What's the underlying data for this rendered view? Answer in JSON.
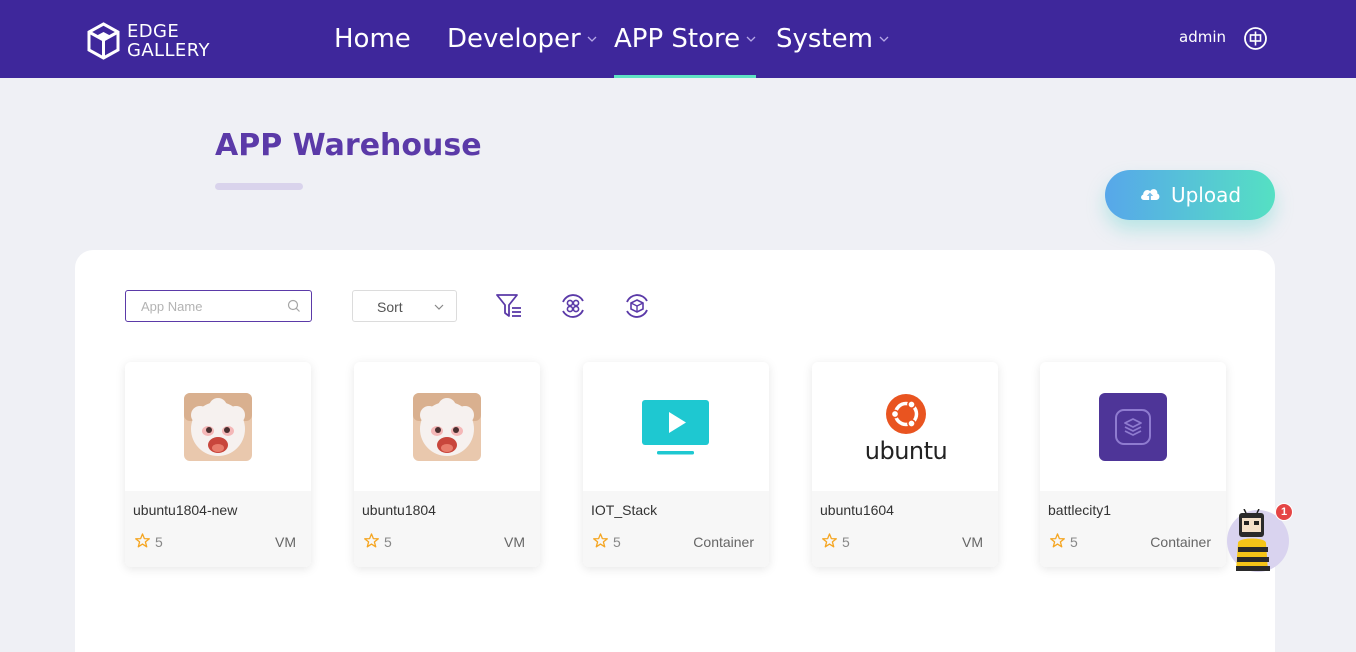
{
  "header": {
    "logo_line1": "EDGE",
    "logo_line2": "GALLERY",
    "nav": [
      {
        "label": "Home",
        "has_dropdown": false,
        "active": false
      },
      {
        "label": "Developer",
        "has_dropdown": true,
        "active": false
      },
      {
        "label": "APP Store",
        "has_dropdown": true,
        "active": true
      },
      {
        "label": "System",
        "has_dropdown": true,
        "active": false
      }
    ],
    "user": "admin",
    "lang_icon": "globe-chinese-icon"
  },
  "page": {
    "title": "APP Warehouse",
    "upload_label": "Upload"
  },
  "toolbar": {
    "search_placeholder": "App Name",
    "sort_label": "Sort",
    "tools": [
      "filter-icon",
      "grid-refresh-icon",
      "cube-refresh-icon"
    ]
  },
  "apps": [
    {
      "name": "ubuntu1804-new",
      "score": "5",
      "type": "VM",
      "icon": "sheep-avatar-icon"
    },
    {
      "name": "ubuntu1804",
      "score": "5",
      "type": "VM",
      "icon": "sheep-avatar-icon"
    },
    {
      "name": "IOT_Stack",
      "score": "5",
      "type": "Container",
      "icon": "tv-play-icon"
    },
    {
      "name": "ubuntu1604",
      "score": "5",
      "type": "VM",
      "icon": "ubuntu-logo-icon",
      "logo_text": "ubuntu"
    },
    {
      "name": "battlecity1",
      "score": "5",
      "type": "Container",
      "icon": "layers-app-icon"
    }
  ],
  "helper": {
    "badge": "1"
  },
  "colors": {
    "header_bg": "#3e279b",
    "accent": "#5b3aa8",
    "active_underline": "#5fe2c4",
    "star": "#f5a623"
  }
}
